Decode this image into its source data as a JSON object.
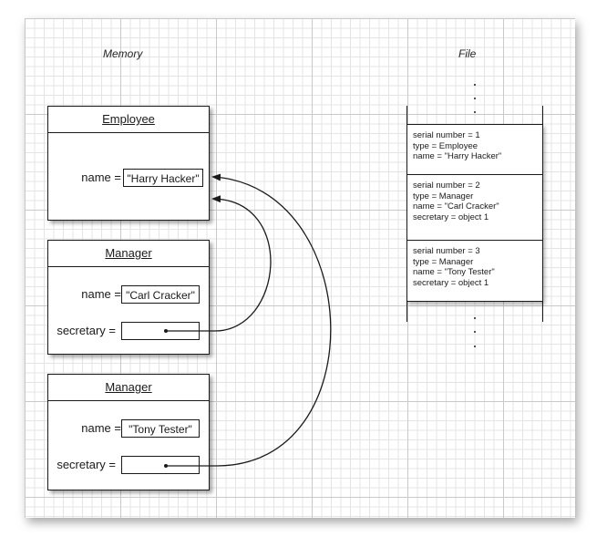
{
  "memory": {
    "title": "Memory",
    "objects": [
      {
        "class_name": "Employee",
        "fields": [
          {
            "label": "name =",
            "value": "\"Harry Hacker\""
          }
        ]
      },
      {
        "class_name": "Manager",
        "fields": [
          {
            "label": "name =",
            "value": "\"Carl Cracker\""
          },
          {
            "label": "secretary =",
            "value": ""
          }
        ]
      },
      {
        "class_name": "Manager",
        "fields": [
          {
            "label": "name =",
            "value": "\"Tony Tester\""
          },
          {
            "label": "secretary =",
            "value": ""
          }
        ]
      }
    ]
  },
  "file": {
    "title": "File",
    "records": [
      {
        "lines": [
          "serial number = 1",
          "type = Employee",
          "name = \"Harry Hacker\""
        ]
      },
      {
        "lines": [
          "serial number = 2",
          "type = Manager",
          "name = \"Carl Cracker\"",
          "secretary = object 1"
        ]
      },
      {
        "lines": [
          "serial number = 3",
          "type = Manager",
          "name = \"Tony Tester\"",
          "secretary = object 1"
        ]
      }
    ]
  },
  "colors": {
    "ink": "#1a1a1a",
    "grid_major": "#c9c9c9",
    "grid_minor": "#e4e4e4"
  }
}
